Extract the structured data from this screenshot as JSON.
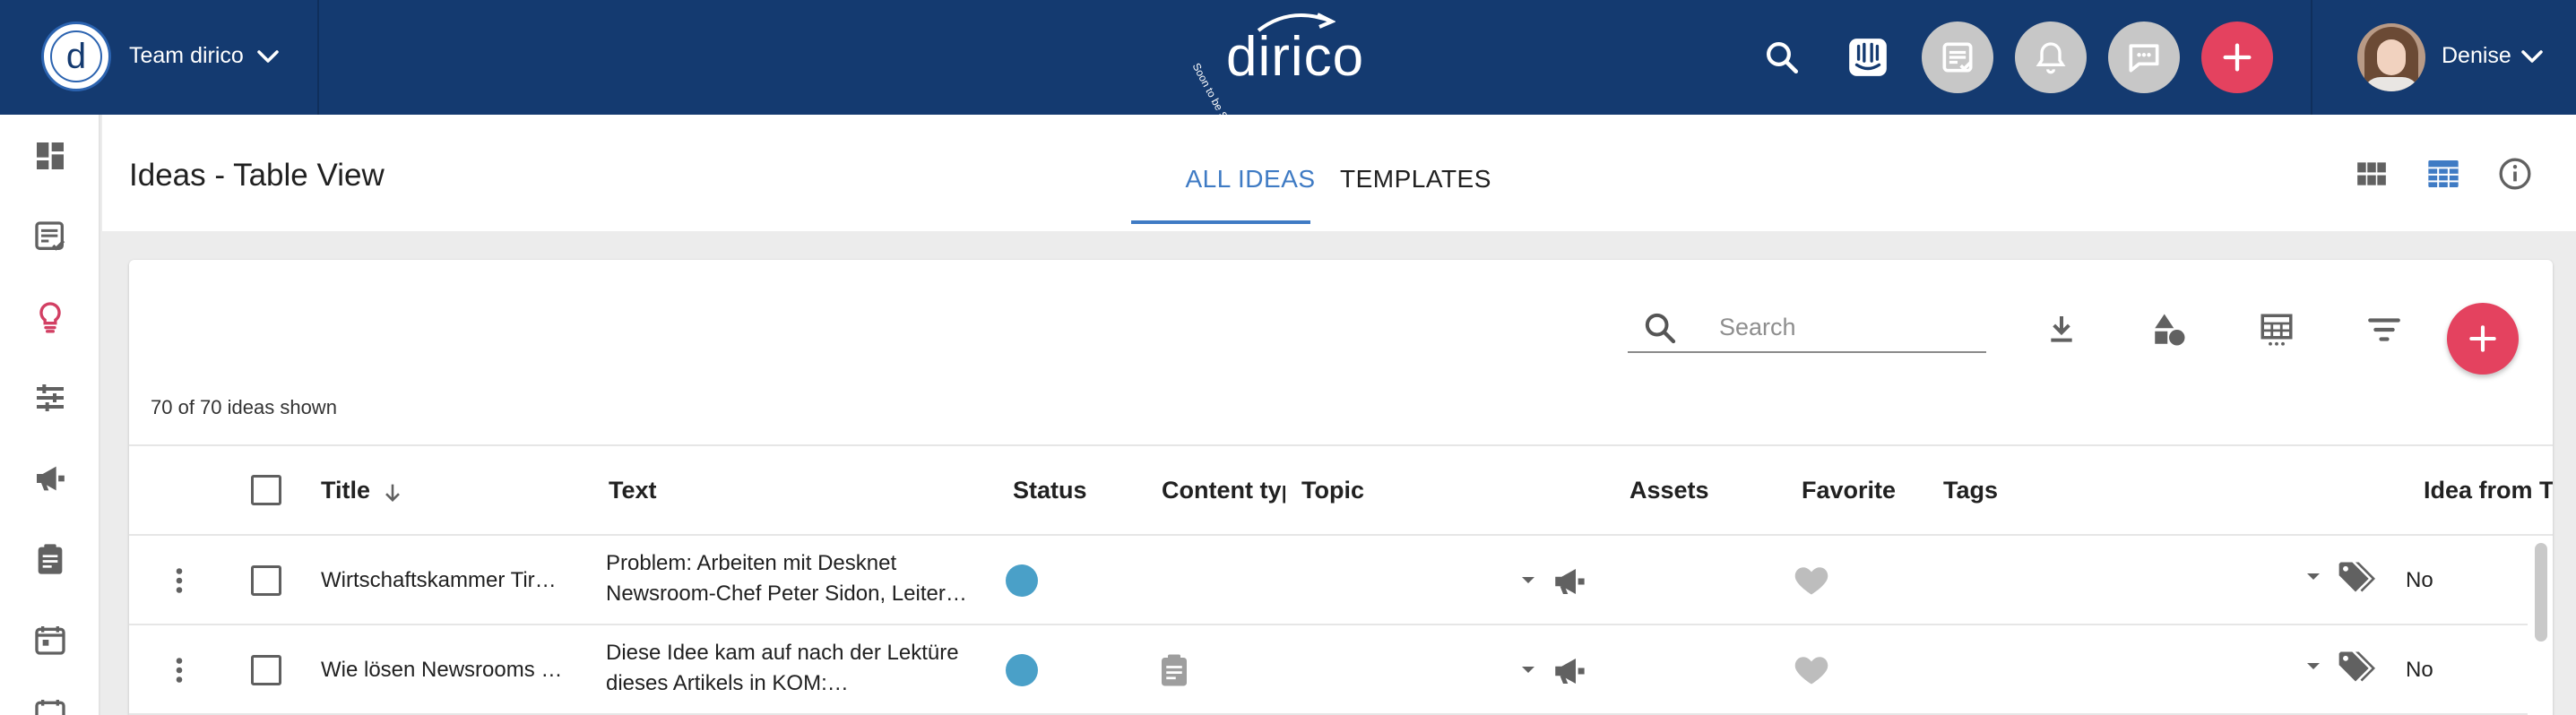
{
  "header": {
    "team_name": "Team dirico",
    "brand_name": "dirico",
    "brand_tagline": "Soon to be Staffbase",
    "user_name": "Denise",
    "icons": [
      "search-icon",
      "intercom-icon",
      "tasks-icon",
      "bell-icon",
      "chat-icon",
      "plus-icon"
    ],
    "accent_color": "#e4425f",
    "bar_color": "#143a70"
  },
  "sidebar": {
    "items": [
      "dashboard-icon",
      "tasks-icon",
      "ideas-icon",
      "planning-icon",
      "campaign-icon",
      "clipboard-icon",
      "calendar-icon",
      "calendar-icon"
    ],
    "active_item": "ideas-icon"
  },
  "page": {
    "title": "Ideas - Table View",
    "tabs": [
      {
        "label": "ALL IDEAS",
        "active": true
      },
      {
        "label": "TEMPLATES",
        "active": false
      }
    ],
    "view_icons": [
      "grid-view-icon",
      "table-view-icon",
      "info-icon"
    ]
  },
  "toolbar": {
    "search_placeholder": "Search",
    "count_text": "70 of 70 ideas shown",
    "icons": [
      "download-icon",
      "shapes-icon",
      "table-columns-icon",
      "filter-icon",
      "add-icon"
    ]
  },
  "table": {
    "columns": [
      "Title",
      "Text",
      "Status",
      "Content typ",
      "Topic",
      "Assets",
      "Favorite",
      "Tags",
      "Idea from T"
    ],
    "rows": [
      {
        "title": "Wirtschaftskammer Tir…",
        "text_line1": "Problem: Arbeiten mit Desknet",
        "text_line2": "Newsroom-Chef Peter Sidon, Leiter…",
        "status_color": "#4aa0c8",
        "content_type": "",
        "idea_from_template": "No"
      },
      {
        "title": "Wie lösen Newsrooms …",
        "text_line1": "Diese Idee kam auf nach der Lektüre",
        "text_line2": "dieses Artikels in KOM:…",
        "status_color": "#4aa0c8",
        "content_type": "clipboard-icon",
        "idea_from_template": "No"
      }
    ]
  }
}
